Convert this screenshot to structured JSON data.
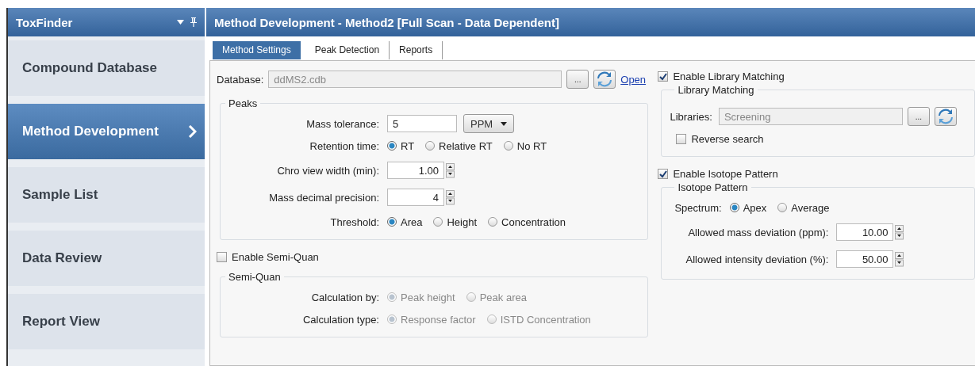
{
  "sidebar": {
    "title": "ToxFinder",
    "items": [
      {
        "label": "Compound Database",
        "selected": false
      },
      {
        "label": "Method Development",
        "selected": true
      },
      {
        "label": "Sample List",
        "selected": false
      },
      {
        "label": "Data Review",
        "selected": false
      },
      {
        "label": "Report View",
        "selected": false
      }
    ]
  },
  "main": {
    "title": "Method Development - Method2 [Full Scan - Data Dependent]",
    "tabs": [
      {
        "label": "Method Settings",
        "selected": true
      },
      {
        "label": "Peak Detection",
        "selected": false
      },
      {
        "label": "Reports",
        "selected": false
      }
    ],
    "database": {
      "label": "Database:",
      "value": "ddMS2.cdb",
      "browse": "...",
      "link": "Open"
    },
    "left_sections": [
      {
        "title": "Peaks",
        "disabled": false,
        "rows": [
          {
            "kind": "text_unit",
            "label": "Mass tolerance:",
            "value": "5",
            "unit": "PPM"
          },
          {
            "kind": "radio",
            "label": "Retention time:",
            "options": [
              {
                "label": "RT",
                "selected": true
              },
              {
                "label": "Relative RT",
                "selected": false
              },
              {
                "label": "No RT",
                "selected": false
              }
            ]
          },
          {
            "kind": "spinner",
            "label": "Chro view width (min):",
            "value": "1.00"
          },
          {
            "kind": "spinner",
            "label": "Mass decimal precision:",
            "value": "4"
          },
          {
            "kind": "radio",
            "label": "Threshold:",
            "options": [
              {
                "label": "Area",
                "selected": true
              },
              {
                "label": "Height",
                "selected": false
              },
              {
                "label": "Concentration",
                "selected": false
              }
            ]
          }
        ]
      },
      {
        "enable": {
          "label": "Enable Semi-Quan",
          "checked": false
        },
        "title": "Semi-Quan",
        "disabled": true,
        "rows": [
          {
            "kind": "radio",
            "label": "Calculation by:",
            "options": [
              {
                "label": "Peak height",
                "selected": true
              },
              {
                "label": "Peak area",
                "selected": false
              }
            ]
          },
          {
            "kind": "radio",
            "label": "Calculation type:",
            "options": [
              {
                "label": "Response factor",
                "selected": true
              },
              {
                "label": "ISTD Concentration",
                "selected": false
              }
            ]
          }
        ]
      }
    ],
    "right_sections": [
      {
        "enable": {
          "label": "Enable Library Matching",
          "checked": true
        },
        "title": "Library Matching",
        "rows": [
          {
            "kind": "browse",
            "label": "Libraries:",
            "value": "Screening",
            "browse": "..."
          },
          {
            "kind": "checkbox",
            "label": "Reverse search",
            "checked": false
          }
        ]
      },
      {
        "enable": {
          "label": "Enable Isotope Pattern",
          "checked": true
        },
        "title": "Isotope Pattern",
        "rows": [
          {
            "kind": "radio",
            "label": "Spectrum:",
            "options": [
              {
                "label": "Apex",
                "selected": true
              },
              {
                "label": "Average",
                "selected": false
              }
            ]
          },
          {
            "kind": "spinner",
            "label": "Allowed mass deviation (ppm):",
            "value": "10.00"
          },
          {
            "kind": "spinner",
            "label": "Allowed intensity deviation (%):",
            "value": "50.00"
          }
        ]
      }
    ]
  }
}
